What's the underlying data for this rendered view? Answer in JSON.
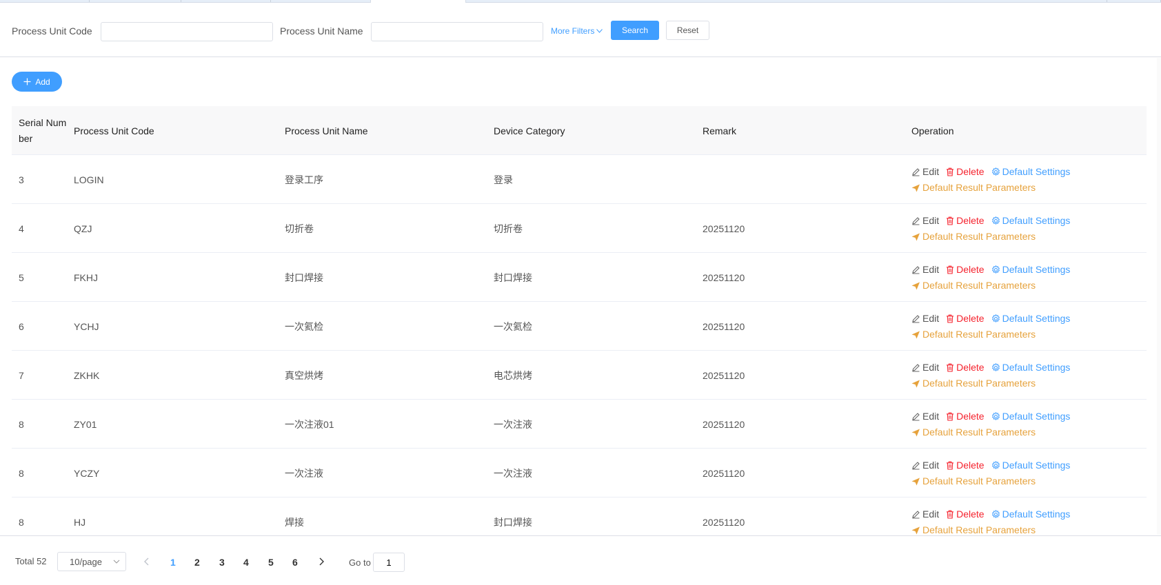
{
  "filters": {
    "code_label": "Process Unit Code",
    "code_value": "",
    "name_label": "Process Unit Name",
    "name_value": "",
    "more_filters": "More Filters",
    "search": "Search",
    "reset": "Reset"
  },
  "toolbar": {
    "add": "Add"
  },
  "table": {
    "headers": [
      "Serial Number",
      "Process Unit Code",
      "Process Unit Name",
      "Device Category",
      "Remark",
      "Operation"
    ],
    "ops": {
      "edit": "Edit",
      "delete": "Delete",
      "settings": "Default Settings",
      "result": "Default Result Parameters"
    },
    "rows": [
      {
        "serial": "3",
        "code": "LOGIN",
        "name": "登录工序",
        "category": "登录",
        "remark": ""
      },
      {
        "serial": "4",
        "code": "QZJ",
        "name": "切折卷",
        "category": "切折卷",
        "remark": "20251120"
      },
      {
        "serial": "5",
        "code": "FKHJ",
        "name": "封口焊接",
        "category": "封口焊接",
        "remark": "20251120"
      },
      {
        "serial": "6",
        "code": "YCHJ",
        "name": "一次氦检",
        "category": "一次氦检",
        "remark": "20251120"
      },
      {
        "serial": "7",
        "code": "ZKHK",
        "name": "真空烘烤",
        "category": "电芯烘烤",
        "remark": "20251120"
      },
      {
        "serial": "8",
        "code": "ZY01",
        "name": "一次注液01",
        "category": "一次注液",
        "remark": "20251120"
      },
      {
        "serial": "8",
        "code": "YCZY",
        "name": "一次注液",
        "category": "一次注液",
        "remark": "20251120"
      },
      {
        "serial": "8",
        "code": "HJ",
        "name": "焊接",
        "category": "封口焊接",
        "remark": "20251120"
      }
    ]
  },
  "pagination": {
    "total": "Total 52",
    "page_size": "10/page",
    "pages": [
      "1",
      "2",
      "3",
      "4",
      "5",
      "6"
    ],
    "current": "1",
    "goto_label": "Go to",
    "goto_value": "1"
  },
  "colors": {
    "primary": "#409eff",
    "danger": "#f5222d",
    "warning": "#e6a23c"
  }
}
